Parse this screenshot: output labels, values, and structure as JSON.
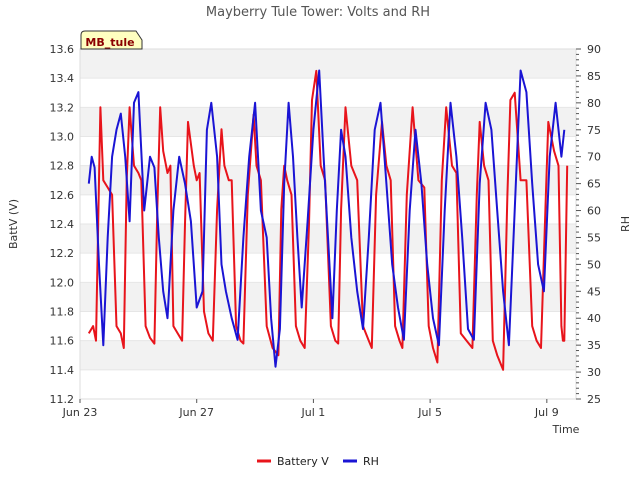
{
  "chart_data": {
    "type": "line",
    "title": "Mayberry Tule Tower: Volts and RH",
    "badge": "MB_tule",
    "xlabel": "Time",
    "ylabel_left": "BattV (V)",
    "ylabel_right": "RH",
    "x_tick_labels": [
      "Jun 23",
      "Jun 27",
      "Jul 1",
      "Jul 5",
      "Jul 9"
    ],
    "x_tick_days": [
      0,
      4,
      8,
      12,
      16
    ],
    "xlim_days": [
      0,
      17
    ],
    "ylim_left": [
      11.2,
      13.6
    ],
    "ylim_right": [
      25,
      90
    ],
    "y_left_ticks": [
      "11.2",
      "11.4",
      "11.6",
      "11.8",
      "12.0",
      "12.2",
      "12.4",
      "12.6",
      "12.8",
      "13.0",
      "13.2",
      "13.4",
      "13.6"
    ],
    "y_right_ticks": [
      "25",
      "30",
      "35",
      "40",
      "45",
      "50",
      "55",
      "60",
      "65",
      "70",
      "75",
      "80",
      "85",
      "90"
    ],
    "legend_position": "bottom-center",
    "grid": "alternating bands",
    "series": [
      {
        "name": "Battery V",
        "axis": "left",
        "color": "#e8141b",
        "x": [
          0.3,
          0.45,
          0.55,
          0.65,
          0.7,
          0.8,
          0.95,
          1.1,
          1.25,
          1.4,
          1.5,
          1.6,
          1.7,
          1.85,
          2.0,
          2.1,
          2.25,
          2.4,
          2.55,
          2.65,
          2.75,
          2.85,
          3.0,
          3.1,
          3.2,
          3.35,
          3.5,
          3.6,
          3.7,
          3.9,
          4.0,
          4.1,
          4.25,
          4.4,
          4.55,
          4.7,
          4.85,
          4.95,
          5.1,
          5.2,
          5.35,
          5.5,
          5.6,
          5.75,
          5.95,
          6.05,
          6.2,
          6.4,
          6.6,
          6.8,
          6.9,
          7.0,
          7.1,
          7.25,
          7.4,
          7.55,
          7.7,
          7.85,
          7.95,
          8.1,
          8.25,
          8.4,
          8.6,
          8.75,
          8.85,
          8.95,
          9.1,
          9.3,
          9.5,
          9.7,
          9.9,
          10.0,
          10.15,
          10.35,
          10.5,
          10.65,
          10.8,
          10.95,
          11.05,
          11.2,
          11.4,
          11.6,
          11.8,
          11.95,
          12.1,
          12.25,
          12.4,
          12.55,
          12.75,
          12.9,
          13.05,
          13.25,
          13.45,
          13.6,
          13.7,
          13.85,
          14.0,
          14.15,
          14.3,
          14.5,
          14.65,
          14.75,
          14.9,
          15.1,
          15.3,
          15.5,
          15.65,
          15.8,
          15.95,
          16.05,
          16.25,
          16.4,
          16.5,
          16.55,
          16.6,
          16.7
        ],
        "values": [
          11.65,
          11.7,
          11.6,
          12.7,
          13.2,
          12.7,
          12.65,
          12.6,
          11.7,
          11.65,
          11.55,
          12.7,
          13.2,
          12.8,
          12.75,
          12.7,
          11.7,
          11.62,
          11.58,
          12.5,
          13.2,
          12.9,
          12.75,
          12.8,
          11.7,
          11.65,
          11.6,
          12.4,
          13.1,
          12.8,
          12.7,
          12.75,
          11.8,
          11.65,
          11.6,
          12.5,
          13.05,
          12.8,
          12.7,
          12.7,
          11.7,
          11.6,
          11.58,
          12.6,
          13.15,
          12.8,
          12.7,
          11.7,
          11.55,
          11.5,
          12.5,
          12.8,
          12.7,
          12.6,
          11.7,
          11.6,
          11.55,
          12.4,
          13.25,
          13.45,
          12.8,
          12.7,
          11.7,
          11.6,
          11.58,
          12.5,
          13.2,
          12.8,
          12.7,
          11.7,
          11.6,
          11.55,
          12.6,
          13.1,
          12.8,
          12.7,
          11.7,
          11.6,
          11.55,
          12.6,
          13.2,
          12.7,
          12.65,
          11.7,
          11.55,
          11.45,
          12.7,
          13.2,
          12.8,
          12.75,
          11.65,
          11.6,
          11.55,
          12.6,
          13.1,
          12.8,
          12.7,
          11.6,
          11.5,
          11.4,
          12.6,
          13.25,
          13.3,
          12.7,
          12.7,
          11.7,
          11.6,
          11.55,
          12.5,
          13.1,
          12.9,
          12.8,
          11.7,
          11.6,
          11.6,
          12.8
        ]
      },
      {
        "name": "RH",
        "axis": "right",
        "color": "#1a14d4",
        "x": [
          0.3,
          0.4,
          0.5,
          0.65,
          0.8,
          0.95,
          1.1,
          1.25,
          1.4,
          1.55,
          1.7,
          1.85,
          2.0,
          2.2,
          2.4,
          2.55,
          2.7,
          2.85,
          3.0,
          3.2,
          3.4,
          3.6,
          3.8,
          4.0,
          4.2,
          4.35,
          4.5,
          4.7,
          4.85,
          5.0,
          5.2,
          5.4,
          5.6,
          5.8,
          6.0,
          6.2,
          6.4,
          6.55,
          6.7,
          6.85,
          7.0,
          7.15,
          7.3,
          7.45,
          7.6,
          7.8,
          8.0,
          8.2,
          8.35,
          8.5,
          8.65,
          8.8,
          8.95,
          9.1,
          9.3,
          9.5,
          9.7,
          9.9,
          10.1,
          10.3,
          10.5,
          10.7,
          10.9,
          11.1,
          11.3,
          11.5,
          11.7,
          11.9,
          12.1,
          12.3,
          12.5,
          12.7,
          12.9,
          13.1,
          13.3,
          13.5,
          13.7,
          13.9,
          14.1,
          14.3,
          14.5,
          14.7,
          14.9,
          15.1,
          15.3,
          15.5,
          15.7,
          15.9,
          16.1,
          16.3,
          16.5,
          16.6
        ],
        "values": [
          65,
          70,
          68,
          50,
          35,
          55,
          70,
          75,
          78,
          70,
          58,
          80,
          82,
          60,
          70,
          68,
          55,
          45,
          40,
          60,
          70,
          65,
          58,
          42,
          45,
          75,
          80,
          70,
          50,
          45,
          40,
          36,
          55,
          70,
          80,
          60,
          55,
          40,
          31,
          38,
          65,
          80,
          70,
          55,
          42,
          58,
          75,
          86,
          70,
          55,
          40,
          60,
          75,
          70,
          55,
          45,
          38,
          55,
          75,
          80,
          65,
          50,
          42,
          36,
          60,
          75,
          65,
          50,
          40,
          35,
          60,
          80,
          70,
          55,
          38,
          36,
          65,
          80,
          75,
          60,
          45,
          35,
          60,
          86,
          82,
          65,
          50,
          45,
          70,
          80,
          70,
          75
        ]
      }
    ]
  }
}
